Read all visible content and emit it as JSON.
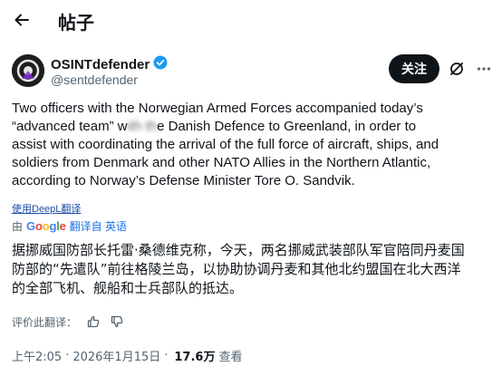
{
  "header": {
    "title": "帖子"
  },
  "author": {
    "name": "OSINTdefender",
    "handle": "@sentdefender",
    "follow_label": "关注"
  },
  "tweet": {
    "text_before": "Two officers with the Norwegian Armed Forces accompanied today’s\n“advanced team” w",
    "text_blurred": "ith th",
    "text_after": "e Danish Defence to Greenland, in order to\nassist with coordinating the arrival of the full force of aircraft, ships, and\nsoldiers from Denmark and other NATO Allies in the Northern Atlantic,\naccording to Norway’s Defense Minister Tore O. Sandvik."
  },
  "translation": {
    "deepl_label": "使用DeepL翻译",
    "by_label": "由",
    "google_letters": [
      "G",
      "o",
      "o",
      "g",
      "l",
      "e"
    ],
    "translated_from": "翻译自 英语",
    "text": "据挪威国防部长托雷·桑德维克称，今天，两名挪威武装部队军官陪同丹麦国\n防部的“先遣队”前往格陵兰岛，以协助协调丹麦和其他北约盟国在北大西洋\n的全部飞机、舰船和士兵部队的抵达。",
    "rate_label": "评价此翻译："
  },
  "meta": {
    "time": "上午2:05",
    "separator": "·",
    "date": "2026年1月15日",
    "views_count": "17.6万",
    "views_label": "查看"
  },
  "colors": {
    "text": "#0f1419",
    "secondary": "#536471",
    "verified": "#1d9bf0",
    "follow_bg": "#0f1419"
  }
}
